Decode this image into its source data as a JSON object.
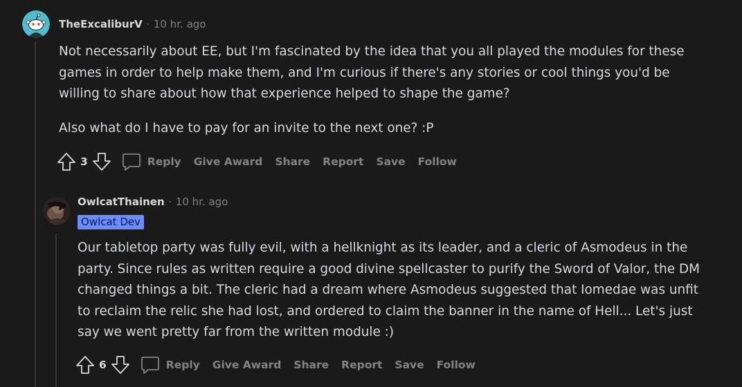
{
  "comments": [
    {
      "username": "TheExcaliburV",
      "separator": "·",
      "time": "10 hr. ago",
      "paragraphs": [
        "Not necessarily about EE, but I'm fascinated by the idea that you all played the modules for these games in order to help make them, and I'm curious if there's any stories or cool things you'd be willing to share about how that experience helped to shape the game?",
        "Also what do I have to pay for an invite to the next one? :P"
      ],
      "score": "3",
      "actions": {
        "reply": "Reply",
        "award": "Give Award",
        "share": "Share",
        "report": "Report",
        "save": "Save",
        "follow": "Follow"
      }
    },
    {
      "username": "OwlcatThainen",
      "separator": "·",
      "time": "10 hr. ago",
      "flair": "Owlcat Dev",
      "paragraphs": [
        "Our tabletop party was fully evil, with a hellknight as its leader, and a cleric of Asmodeus in the party. Since rules as written require a good divine spellcaster to purify the Sword of Valor, the DM changed things a bit. The cleric had a dream where Asmodeus suggested that Iomedae was unfit to reclaim the relic she had lost, and ordered to claim the banner in the name of Hell... Let's just say we went pretty far from the written module :)"
      ],
      "score": "6",
      "actions": {
        "reply": "Reply",
        "award": "Give Award",
        "share": "Share",
        "report": "Report",
        "save": "Save",
        "follow": "Follow"
      }
    }
  ],
  "colors": {
    "background": "#1a1a1b",
    "text": "#d7dadc",
    "muted": "#818384",
    "flair_bg": "#6a8cff",
    "thread_line": "#343536"
  }
}
